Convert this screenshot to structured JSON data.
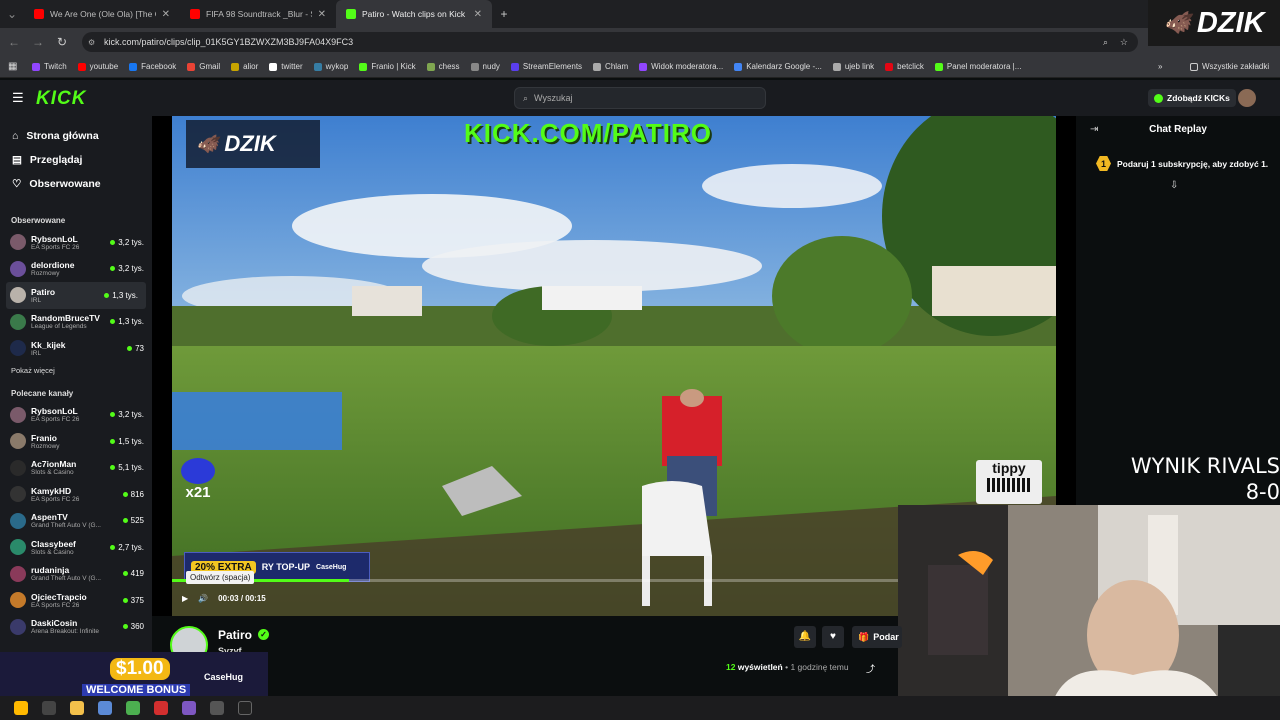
{
  "browser": {
    "tabs": [
      {
        "title": "We Are One (Ole Ola) [The Offi...",
        "favicon_color": "#ff0000"
      },
      {
        "title": "FIFA 98 Soundtrack _Blur - Song...",
        "favicon_color": "#ff0000"
      },
      {
        "title": "Patiro - Watch clips on Kick",
        "favicon_color": "#53fc18"
      }
    ],
    "url": "kick.com/patiro/clips/clip_01K5GY1BZWXZM3BJ9FA04X9FC3",
    "bookmarks": [
      {
        "label": "Twitch",
        "color": "#9146ff"
      },
      {
        "label": "youtube",
        "color": "#ff0000"
      },
      {
        "label": "Facebook",
        "color": "#1877f2"
      },
      {
        "label": "Gmail",
        "color": "#ea4335"
      },
      {
        "label": "alior",
        "color": "#c8a400"
      },
      {
        "label": "twitter",
        "color": "#ffffff"
      },
      {
        "label": "wykop",
        "color": "#367da4"
      },
      {
        "label": "Franio | Kick",
        "color": "#53fc18"
      },
      {
        "label": "chess",
        "color": "#7fa650"
      },
      {
        "label": "nudy",
        "color": "#888888"
      },
      {
        "label": "StreamElements",
        "color": "#5a3eed"
      },
      {
        "label": "Chlam",
        "color": "#aaaaaa"
      },
      {
        "label": "Widok moderatora...",
        "color": "#9146ff"
      },
      {
        "label": "Kalendarz Google -...",
        "color": "#4285f4"
      },
      {
        "label": "ujeb link",
        "color": "#aaaaaa"
      },
      {
        "label": "betclick",
        "color": "#e30613"
      },
      {
        "label": "Panel moderatora |...",
        "color": "#53fc18"
      }
    ],
    "all_bookmarks": "Wszystkie zakładki"
  },
  "kick": {
    "logo": "KICK",
    "search_placeholder": "Wyszukaj",
    "kicks_button": "Zdobądź KICKs"
  },
  "sidebar": {
    "nav": [
      {
        "label": "Strona główna",
        "icon": "home-icon"
      },
      {
        "label": "Przeglądaj",
        "icon": "browse-icon"
      },
      {
        "label": "Obserwowane",
        "icon": "heart-icon"
      }
    ],
    "followed_header": "Obserwowane",
    "followed": [
      {
        "name": "RybsonLoL",
        "category": "EA Sports FC 26",
        "viewers": "3,2 tys.",
        "avatar": "#7a5a6a"
      },
      {
        "name": "delordione",
        "category": "Rozmowy",
        "viewers": "3,2 tys.",
        "avatar": "#6b4f9a"
      },
      {
        "name": "Patiro",
        "category": "IRL",
        "viewers": "1,3 tys.",
        "avatar": "#b9b2aa"
      },
      {
        "name": "RandomBruceTV",
        "category": "League of Legends",
        "viewers": "1,3 tys.",
        "avatar": "#3a7a4a"
      },
      {
        "name": "Kk_kijek",
        "category": "IRL",
        "viewers": "73",
        "avatar": "#1e2a4a"
      }
    ],
    "show_more": "Pokaż więcej",
    "recommended_header": "Polecane kanały",
    "recommended": [
      {
        "name": "RybsonLoL",
        "category": "EA Sports FC 26",
        "viewers": "3,2 tys.",
        "avatar": "#7a5a6a"
      },
      {
        "name": "Franio",
        "category": "Rozmowy",
        "viewers": "1,5 tys.",
        "avatar": "#8a7a6a"
      },
      {
        "name": "Ac7ionMan",
        "category": "Slots & Casino",
        "viewers": "5,1 tys.",
        "avatar": "#2a2a2a"
      },
      {
        "name": "KamykHD",
        "category": "EA Sports FC 26",
        "viewers": "816",
        "avatar": "#333333"
      },
      {
        "name": "AspenTV",
        "category": "Grand Theft Auto V (G...",
        "viewers": "525",
        "avatar": "#2a6a8a"
      },
      {
        "name": "Classybeef",
        "category": "Slots & Casino",
        "viewers": "2,7 tys.",
        "avatar": "#2a8a6a"
      },
      {
        "name": "rudaninja",
        "category": "Grand Theft Auto V (G...",
        "viewers": "419",
        "avatar": "#8a3a5a"
      },
      {
        "name": "OjciecTrapcio",
        "category": "EA Sports FC 26",
        "viewers": "375",
        "avatar": "#c47a2a"
      },
      {
        "name": "DaskiCosin",
        "category": "Arena Breakout: Infinite",
        "viewers": "360",
        "avatar": "#3a3a6a"
      }
    ]
  },
  "player": {
    "overlay_brand": "DZIK",
    "overlay_url": "KICK.COM/PATIRO",
    "tippy": "tippy",
    "sticker": "x21",
    "promo_pct": "20% EXTRA",
    "promo_text": "RY TOP-UP",
    "promo_brand": "CaseHug",
    "tooltip": "Odtwórz (spacja)",
    "time_current": "00:03",
    "time_total": "00:15",
    "progress": 0.2
  },
  "chat": {
    "title": "Chat Replay",
    "gift_count": "1",
    "gift_text": "Podaruj 1 subskrypcję, aby zdobyć 1."
  },
  "overlay": {
    "wynik_line1": "WYNIK RIVALS",
    "wynik_line2": "8-0",
    "dzik_corner": "DZIK"
  },
  "info": {
    "streamer": "Patiro",
    "clip_title": "Syzyf",
    "gift_btn": "Podar",
    "views_count": "12",
    "views_label": "wyświetleń",
    "time_ago": "1 godzinę temu"
  },
  "welcome": {
    "amount": "$1.00",
    "text": "WELCOME BONUS",
    "brand": "CaseHug"
  }
}
